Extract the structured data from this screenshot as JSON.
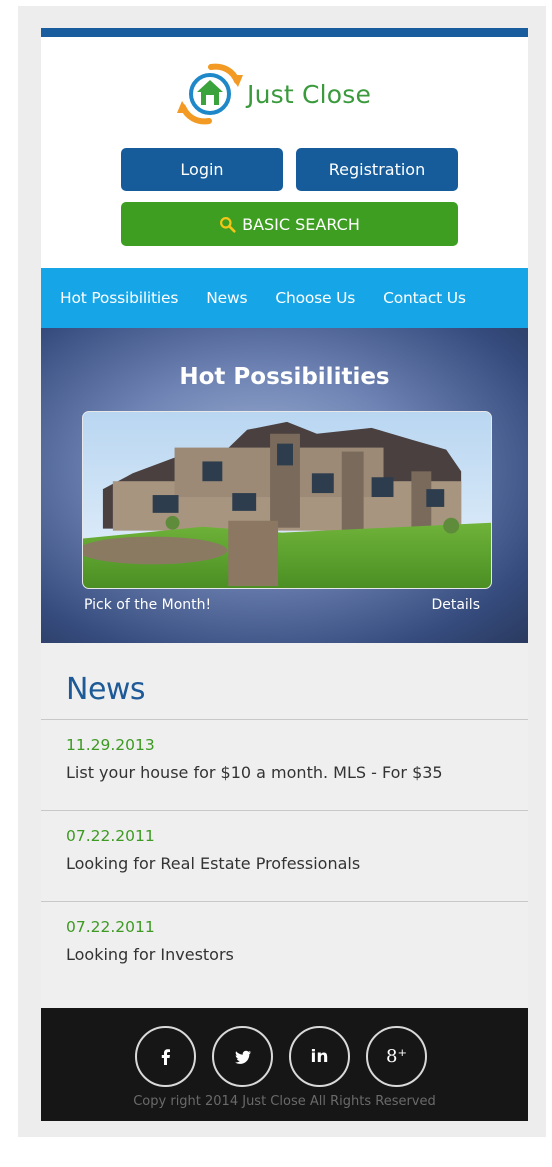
{
  "brand": {
    "name": "Just Close"
  },
  "header": {
    "login_label": "Login",
    "registration_label": "Registration",
    "search_label": "BASIC SEARCH"
  },
  "nav": {
    "items": [
      {
        "label": "Hot Possibilities"
      },
      {
        "label": "News"
      },
      {
        "label": "Choose Us"
      },
      {
        "label": "Contact Us"
      }
    ]
  },
  "hero": {
    "title": "Hot Possibilities",
    "caption": "Pick of the Month!",
    "details_label": "Details"
  },
  "news": {
    "heading": "News",
    "items": [
      {
        "date": "11.29.2013",
        "text": "List your house for $10 a month. MLS - For $35"
      },
      {
        "date": "07.22.2011",
        "text": "Looking for Real Estate Professionals"
      },
      {
        "date": "07.22.2011",
        "text": "Looking for Investors"
      }
    ]
  },
  "footer": {
    "socials": [
      {
        "icon": "facebook-icon"
      },
      {
        "icon": "twitter-icon"
      },
      {
        "icon": "linkedin-icon",
        "text": "in"
      },
      {
        "icon": "google-plus-icon",
        "text": "8⁺"
      }
    ],
    "copyright": "Copy right 2014 Just Close All Rights Reserved"
  },
  "colors": {
    "top_bar": "#1a5d9e",
    "primary_button": "#165c9b",
    "search_button": "#3e9e22",
    "nav_bar": "#16a6e8",
    "news_date": "#3d9a22",
    "news_heading": "#1d5a97",
    "footer": "#161616"
  }
}
